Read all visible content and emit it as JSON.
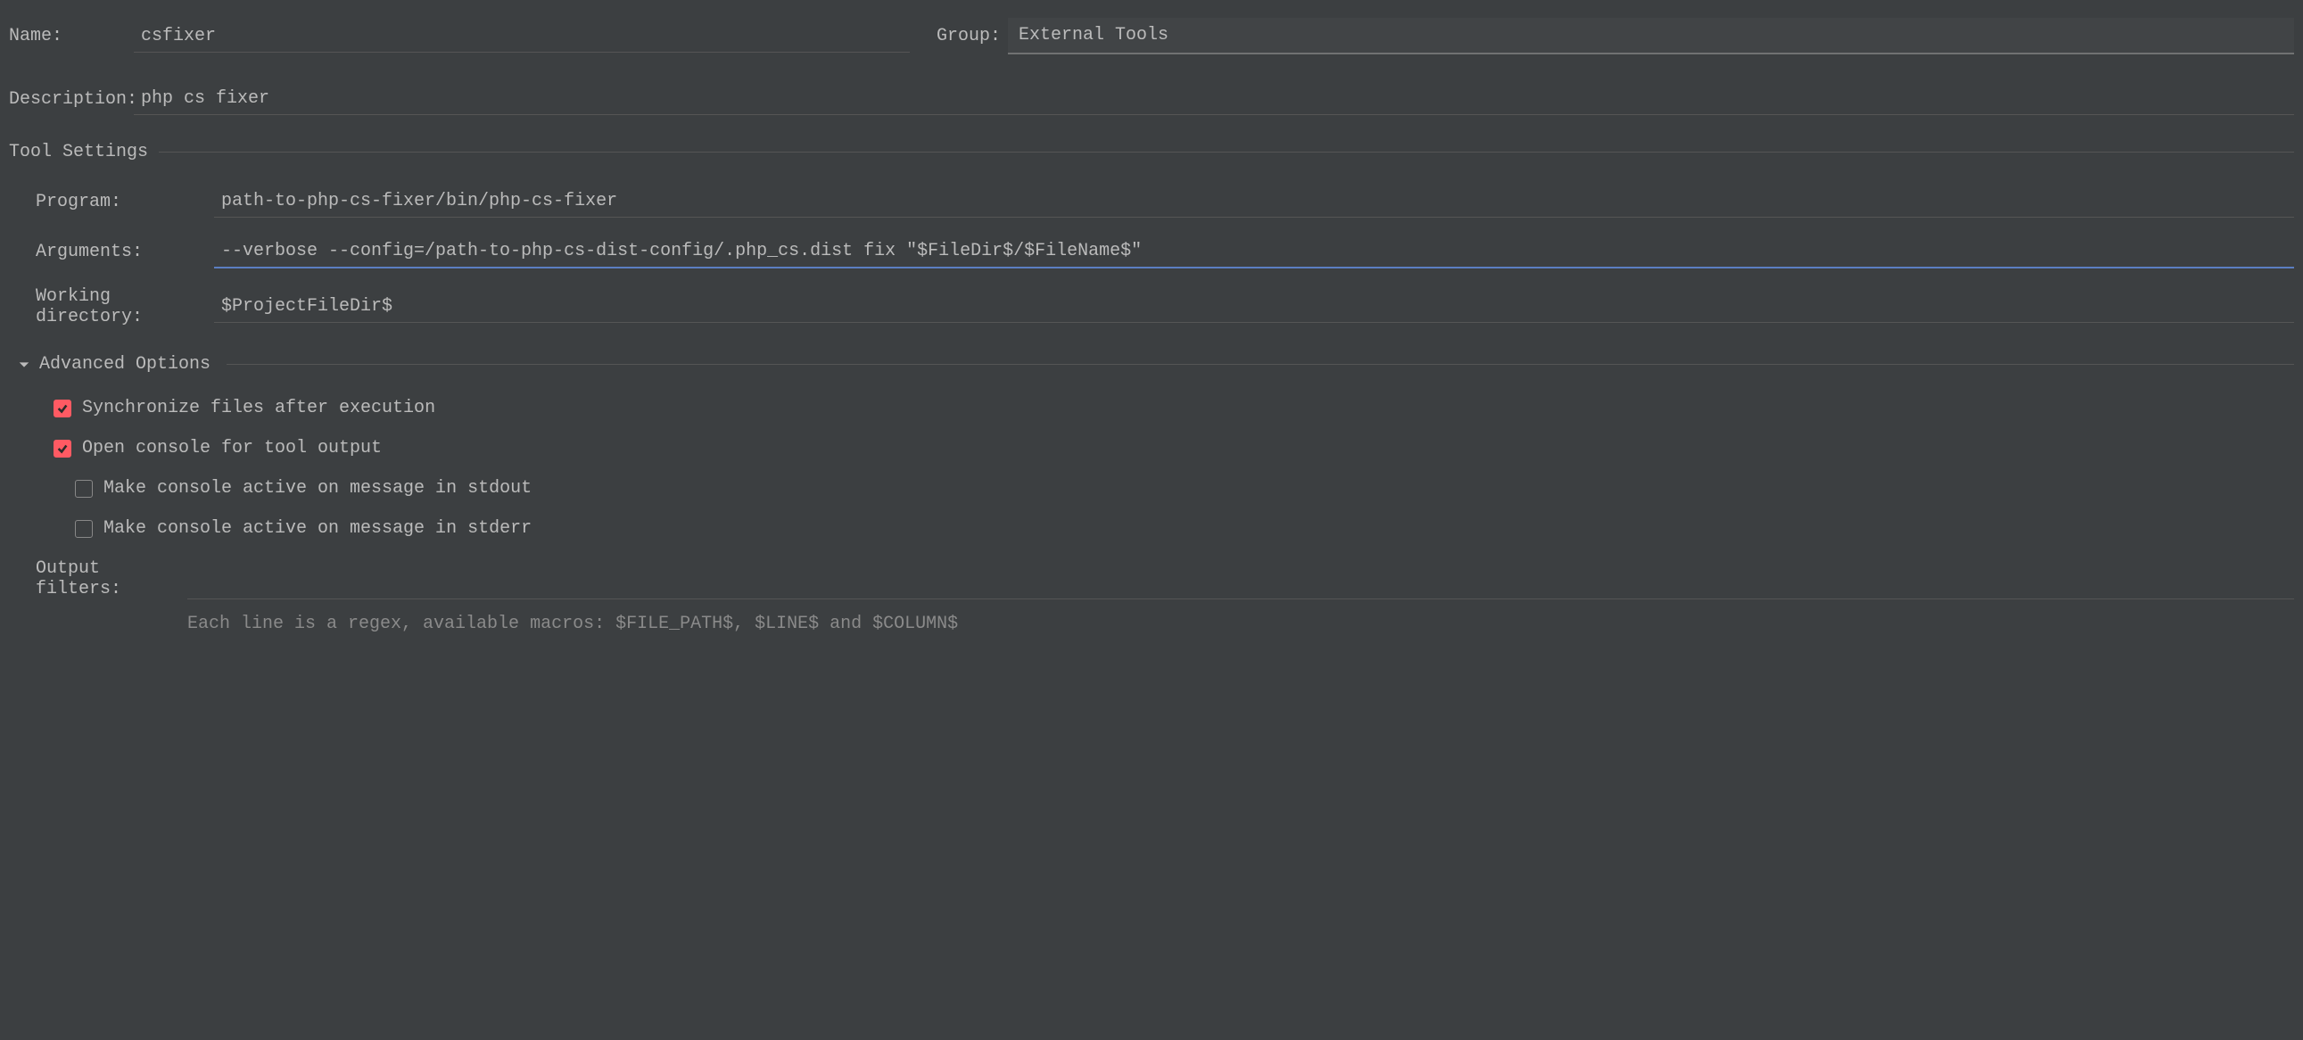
{
  "name": {
    "label": "Name:",
    "value": "csfixer"
  },
  "group": {
    "label": "Group:",
    "value": "External Tools"
  },
  "description": {
    "label": "Description:",
    "value": "php cs fixer"
  },
  "tool_settings": {
    "title": "Tool Settings",
    "program": {
      "label": "Program:",
      "value": "path-to-php-cs-fixer/bin/php-cs-fixer"
    },
    "arguments": {
      "label": "Arguments:",
      "value": "--verbose --config=/path-to-php-cs-dist-config/.php_cs.dist fix \"$FileDir$/$FileName$\""
    },
    "working_directory": {
      "label": "Working directory:",
      "value": "$ProjectFileDir$"
    }
  },
  "advanced": {
    "title": "Advanced Options",
    "sync_files": {
      "label": "Synchronize files after execution",
      "checked": true
    },
    "open_console": {
      "label": "Open console for tool output",
      "checked": true
    },
    "stdout_active": {
      "label": "Make console active on message in stdout",
      "checked": false
    },
    "stderr_active": {
      "label": "Make console active on message in stderr",
      "checked": false
    },
    "output_filters": {
      "label": "Output filters:",
      "value": ""
    },
    "hint": "Each line is a regex, available macros: $FILE_PATH$, $LINE$ and $COLUMN$"
  }
}
